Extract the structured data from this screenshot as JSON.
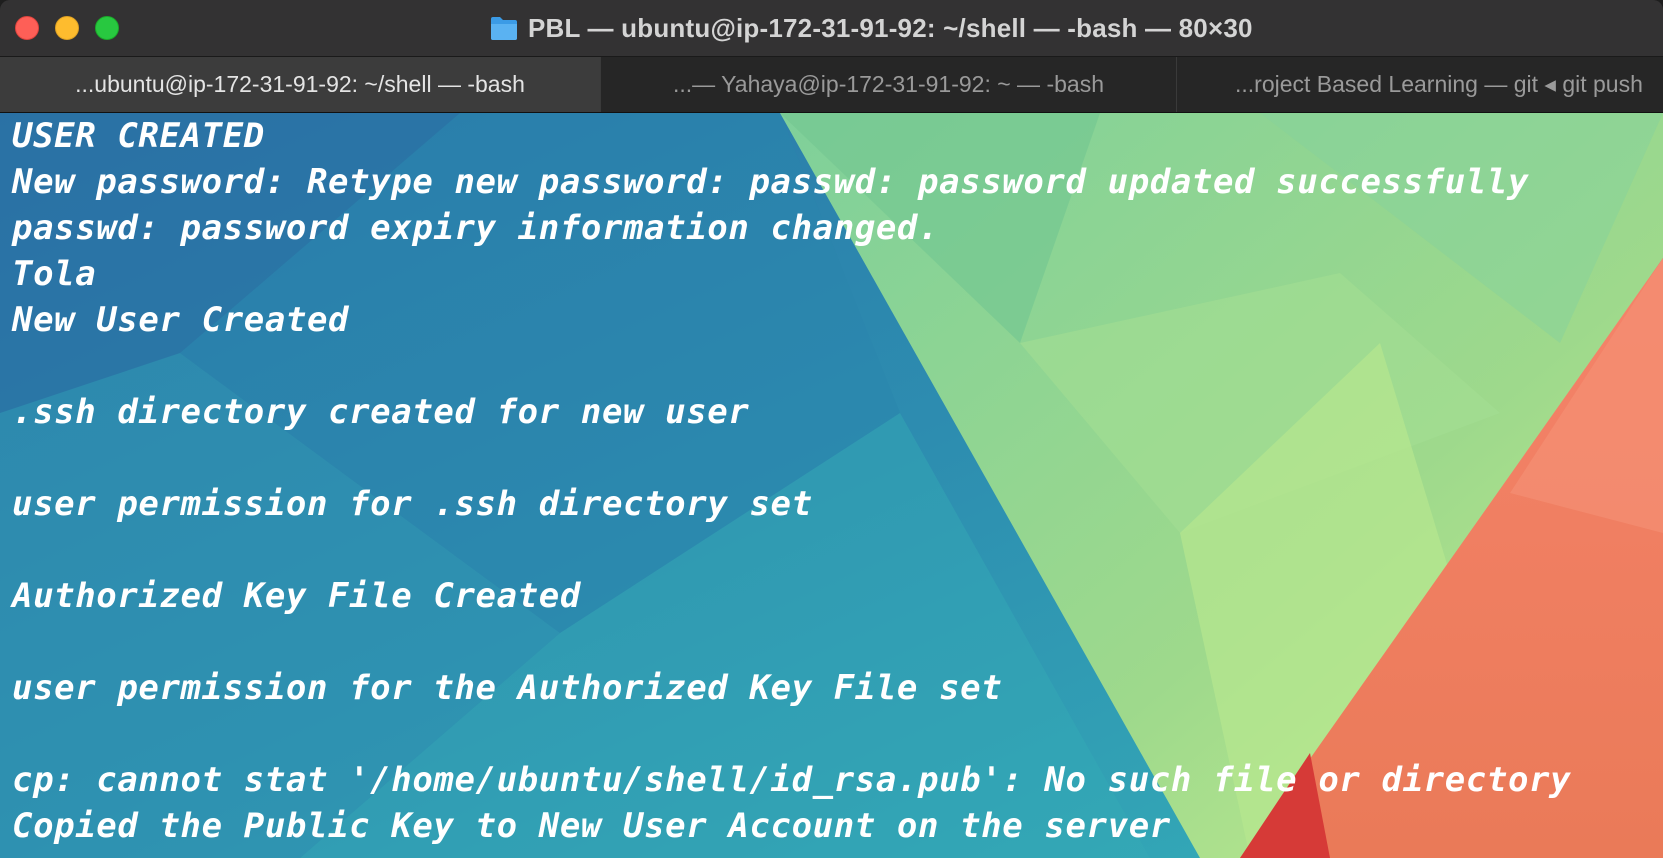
{
  "window": {
    "title": "PBL — ubuntu@ip-172-31-91-92: ~/shell — -bash — 80×30",
    "title_icon": "folder-icon"
  },
  "tabs": [
    {
      "label": "...ubuntu@ip-172-31-91-92: ~/shell — -bash",
      "active": true
    },
    {
      "label": "...— Yahaya@ip-172-31-91-92: ~ — -bash",
      "active": false
    },
    {
      "label": "...roject Based Learning — git ◂ git push",
      "active": false
    }
  ],
  "terminal": {
    "lines": [
      "USER CREATED",
      "New password: Retype new password: passwd: password updated successfully",
      "passwd: password expiry information changed.",
      "Tola",
      "New User Created",
      "",
      ".ssh directory created for new user",
      "",
      "user permission for .ssh directory set",
      "",
      "Authorized Key File Created",
      "",
      "user permission for the Authorized Key File set",
      "",
      "cp: cannot stat '/home/ubuntu/shell/id_rsa.pub': No such file or directory",
      "Copied the Public Key to New User Account on the server"
    ]
  },
  "colors": {
    "close": "#fe5f57",
    "minimize": "#febc2e",
    "maximize": "#28c840",
    "text": "#ffffff",
    "bg_blue": "#2a7fae",
    "bg_green": "#8fd49a",
    "bg_orange": "#f27f63"
  }
}
